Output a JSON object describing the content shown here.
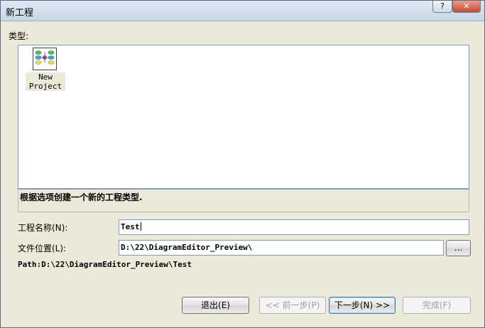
{
  "window": {
    "title": "新工程",
    "help_label": "?",
    "close_label": "✕"
  },
  "type_section": {
    "label": "类型:",
    "items": [
      {
        "label_line1": "New",
        "label_line2": "Project",
        "icon": "project-diagram-icon"
      }
    ]
  },
  "description": "根据选项创建一个新的工程类型.",
  "fields": {
    "name": {
      "label": "工程名称(N):",
      "value": "Test"
    },
    "location": {
      "label": "文件位置(L):",
      "value": "D:\\22\\DiagramEditor_Preview\\",
      "browse_label": "..."
    }
  },
  "path_text": "Path:D:\\22\\DiagramEditor_Preview\\Test",
  "buttons": {
    "exit": "退出(E)",
    "back": "<< 前一步(P)",
    "next": "下一步(N) >>",
    "finish": "完成(F)"
  },
  "colors": {
    "title_bar": "#c6d6e6",
    "close_button": "#c8492f",
    "dialog_bg": "#ece9d8",
    "input_border": "#7f9db9"
  }
}
